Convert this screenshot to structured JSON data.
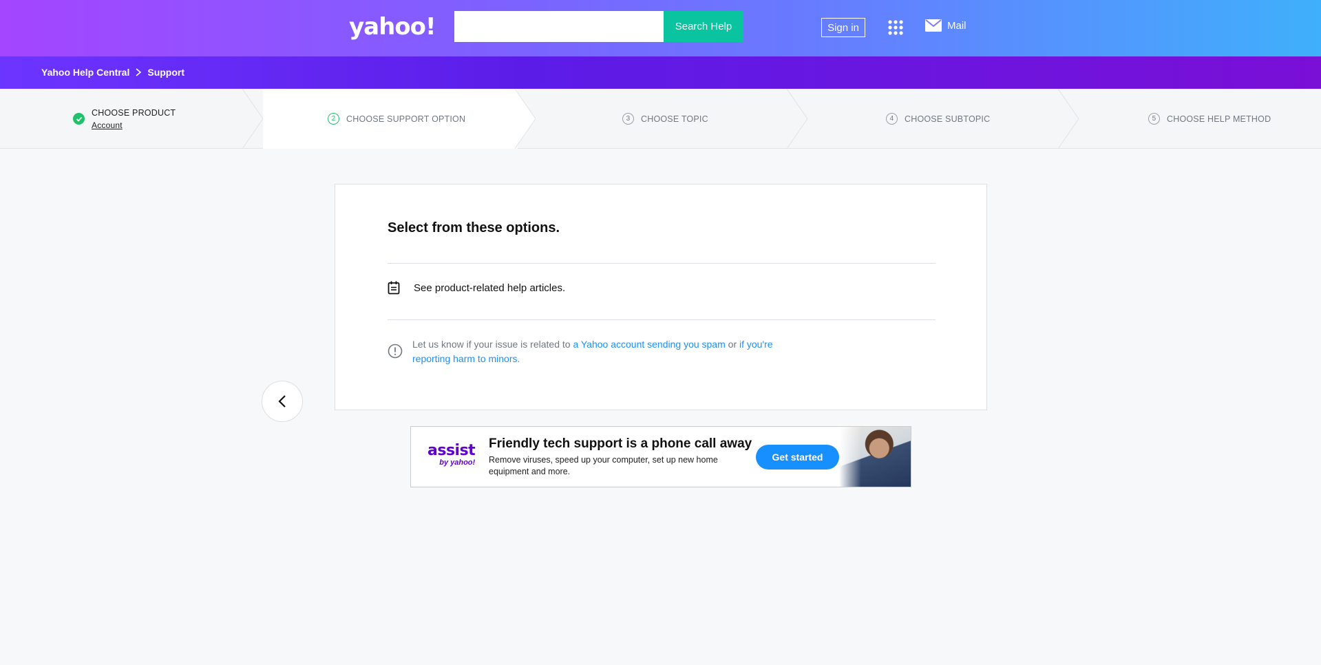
{
  "header": {
    "logo": "yahoo!",
    "search": {
      "placeholder": "",
      "button_label": "Search Help"
    },
    "signin_label": "Sign in",
    "mail_label": "Mail"
  },
  "breadcrumb": {
    "items": [
      "Yahoo Help Central",
      "Support"
    ]
  },
  "steps": [
    {
      "label": "CHOOSE PRODUCT",
      "sub": "Account",
      "state": "done"
    },
    {
      "num": "2",
      "label": "CHOOSE SUPPORT OPTION",
      "state": "active"
    },
    {
      "num": "3",
      "label": "CHOOSE TOPIC",
      "state": "pending"
    },
    {
      "num": "4",
      "label": "CHOOSE SUBTOPIC",
      "state": "pending"
    },
    {
      "num": "5",
      "label": "CHOOSE HELP METHOD",
      "state": "pending"
    }
  ],
  "card": {
    "title": "Select from these options.",
    "option_label": "See product-related help articles.",
    "notice": {
      "prefix": "Let us know if your issue is related to ",
      "link1": "a Yahoo account sending you spam",
      "middle": " or ",
      "link2": "if you're reporting harm to minors."
    }
  },
  "ad": {
    "logo_big": "assist",
    "logo_small": "by yahoo!",
    "headline": "Friendly tech support is a phone call away",
    "body": "Remove viruses, speed up your computer, set up new home equipment and more.",
    "cta": "Get started"
  },
  "colors": {
    "accent_green": "#0ac4a0",
    "link_blue": "#188fff",
    "brand_purple": "#6001d2"
  }
}
